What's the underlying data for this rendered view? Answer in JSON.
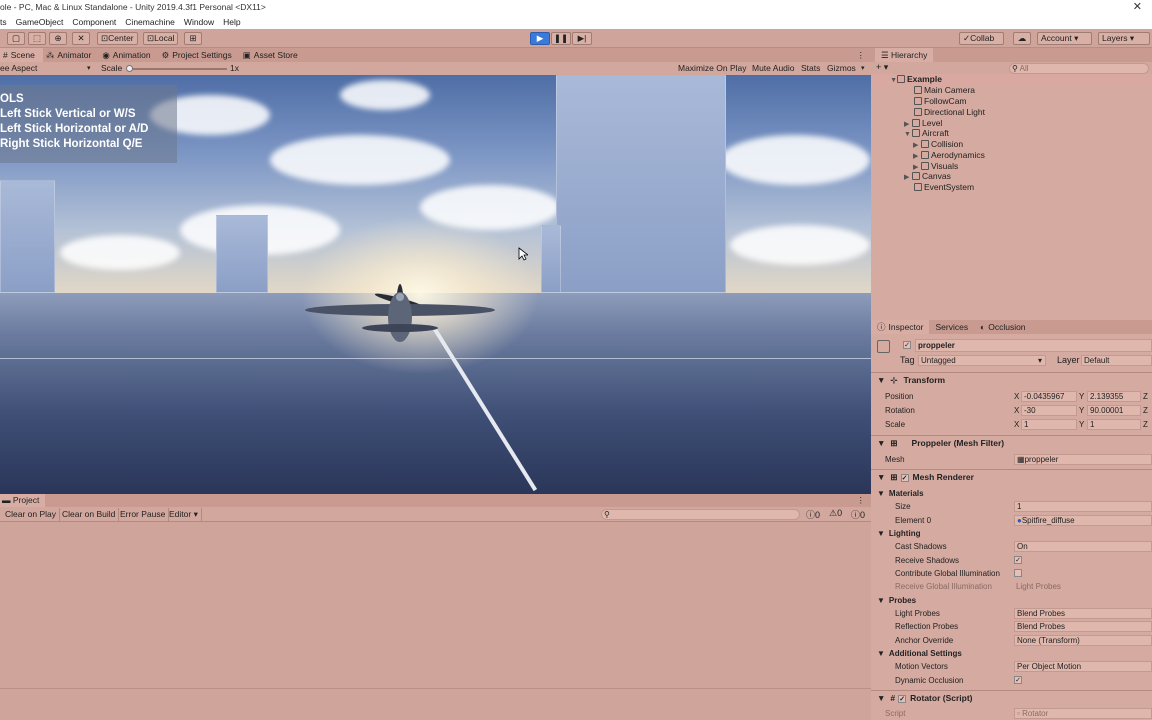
{
  "window": {
    "title": "ole - PC, Mac & Linux Standalone - Unity 2019.4.3f1 Personal <DX11>",
    "close": "✕"
  },
  "menu": [
    "ts",
    "GameObject",
    "Component",
    "Cinemachine",
    "Window",
    "Help"
  ],
  "toolbar": {
    "center": "Center",
    "local": "Local",
    "collab": "Collab",
    "account": "Account",
    "layers": "Layers"
  },
  "game_tabs": [
    "Scene",
    "Animator",
    "Animation",
    "Project Settings",
    "Asset Store"
  ],
  "game_controls": {
    "aspect": "ee Aspect",
    "scale_label": "Scale",
    "scale_value": "1x",
    "maximize": "Maximize On Play",
    "mute": "Mute Audio",
    "stats": "Stats",
    "gizmos": "Gizmos"
  },
  "overlay": {
    "title": "OLS",
    "line1": "Left Stick Vertical or W/S",
    "line2": "Left Stick Horizontal or A/D",
    "line3": "Right Stick Horizontal Q/E"
  },
  "hierarchy": {
    "tab": "Hierarchy",
    "search": "All",
    "items": [
      "Example",
      "Main Camera",
      "FollowCam",
      "Directional Light",
      "Level",
      "Aircraft",
      "Collision",
      "Aerodynamics",
      "Visuals",
      "Canvas",
      "EventSystem"
    ]
  },
  "inspector": {
    "tabs": [
      "Inspector",
      "Services",
      "Occlusion"
    ],
    "object_name": "proppeler",
    "tag_label": "Tag",
    "tag_value": "Untagged",
    "layer_label": "Layer",
    "layer_value": "Default",
    "transform": {
      "title": "Transform",
      "position_label": "Position",
      "pos_x": "-0.0435967",
      "pos_y": "2.139355",
      "rotation_label": "Rotation",
      "rot_x": "-30",
      "rot_y": "90.00001",
      "scale_label": "Scale",
      "scale_x": "1",
      "scale_y": "1",
      "x": "X",
      "y": "Y",
      "z": "Z"
    },
    "mesh_filter": {
      "title": "Proppeler (Mesh Filter)",
      "mesh_label": "Mesh",
      "mesh_value": "proppeler"
    },
    "mesh_renderer": {
      "title": "Mesh Renderer",
      "materials": "Materials",
      "size_label": "Size",
      "size_value": "1",
      "element0_label": "Element 0",
      "element0_value": "Spitfire_diffuse",
      "lighting": "Lighting",
      "cast_shadows_label": "Cast Shadows",
      "cast_shadows_value": "On",
      "receive_shadows_label": "Receive Shadows",
      "contribute_gi_label": "Contribute Global Illumination",
      "receive_gi_label": "Receive Global Illumination",
      "receive_gi_value": "Light Probes",
      "probes": "Probes",
      "light_probes_label": "Light Probes",
      "light_probes_value": "Blend Probes",
      "reflection_probes_label": "Reflection Probes",
      "reflection_probes_value": "Blend Probes",
      "anchor_override_label": "Anchor Override",
      "anchor_override_value": "None (Transform)",
      "additional": "Additional Settings",
      "motion_vectors_label": "Motion Vectors",
      "motion_vectors_value": "Per Object Motion",
      "dynamic_occlusion_label": "Dynamic Occlusion"
    },
    "rotator": {
      "title": "Rotator (Script)",
      "script_label": "Script",
      "script_value": "Rotator"
    }
  },
  "project_tab": "Project",
  "console": {
    "clear_on_play": "Clear on Play",
    "clear_on_build": "Clear on Build",
    "error_pause": "Error Pause",
    "editor": "Editor",
    "count_errors": "0",
    "count_warnings": "0",
    "count_logs": "0"
  },
  "colors": {
    "panel": "#cfa49a",
    "header": "#c99a90",
    "field": "#e0b7ad",
    "play_blue": "#3a7ad8"
  }
}
